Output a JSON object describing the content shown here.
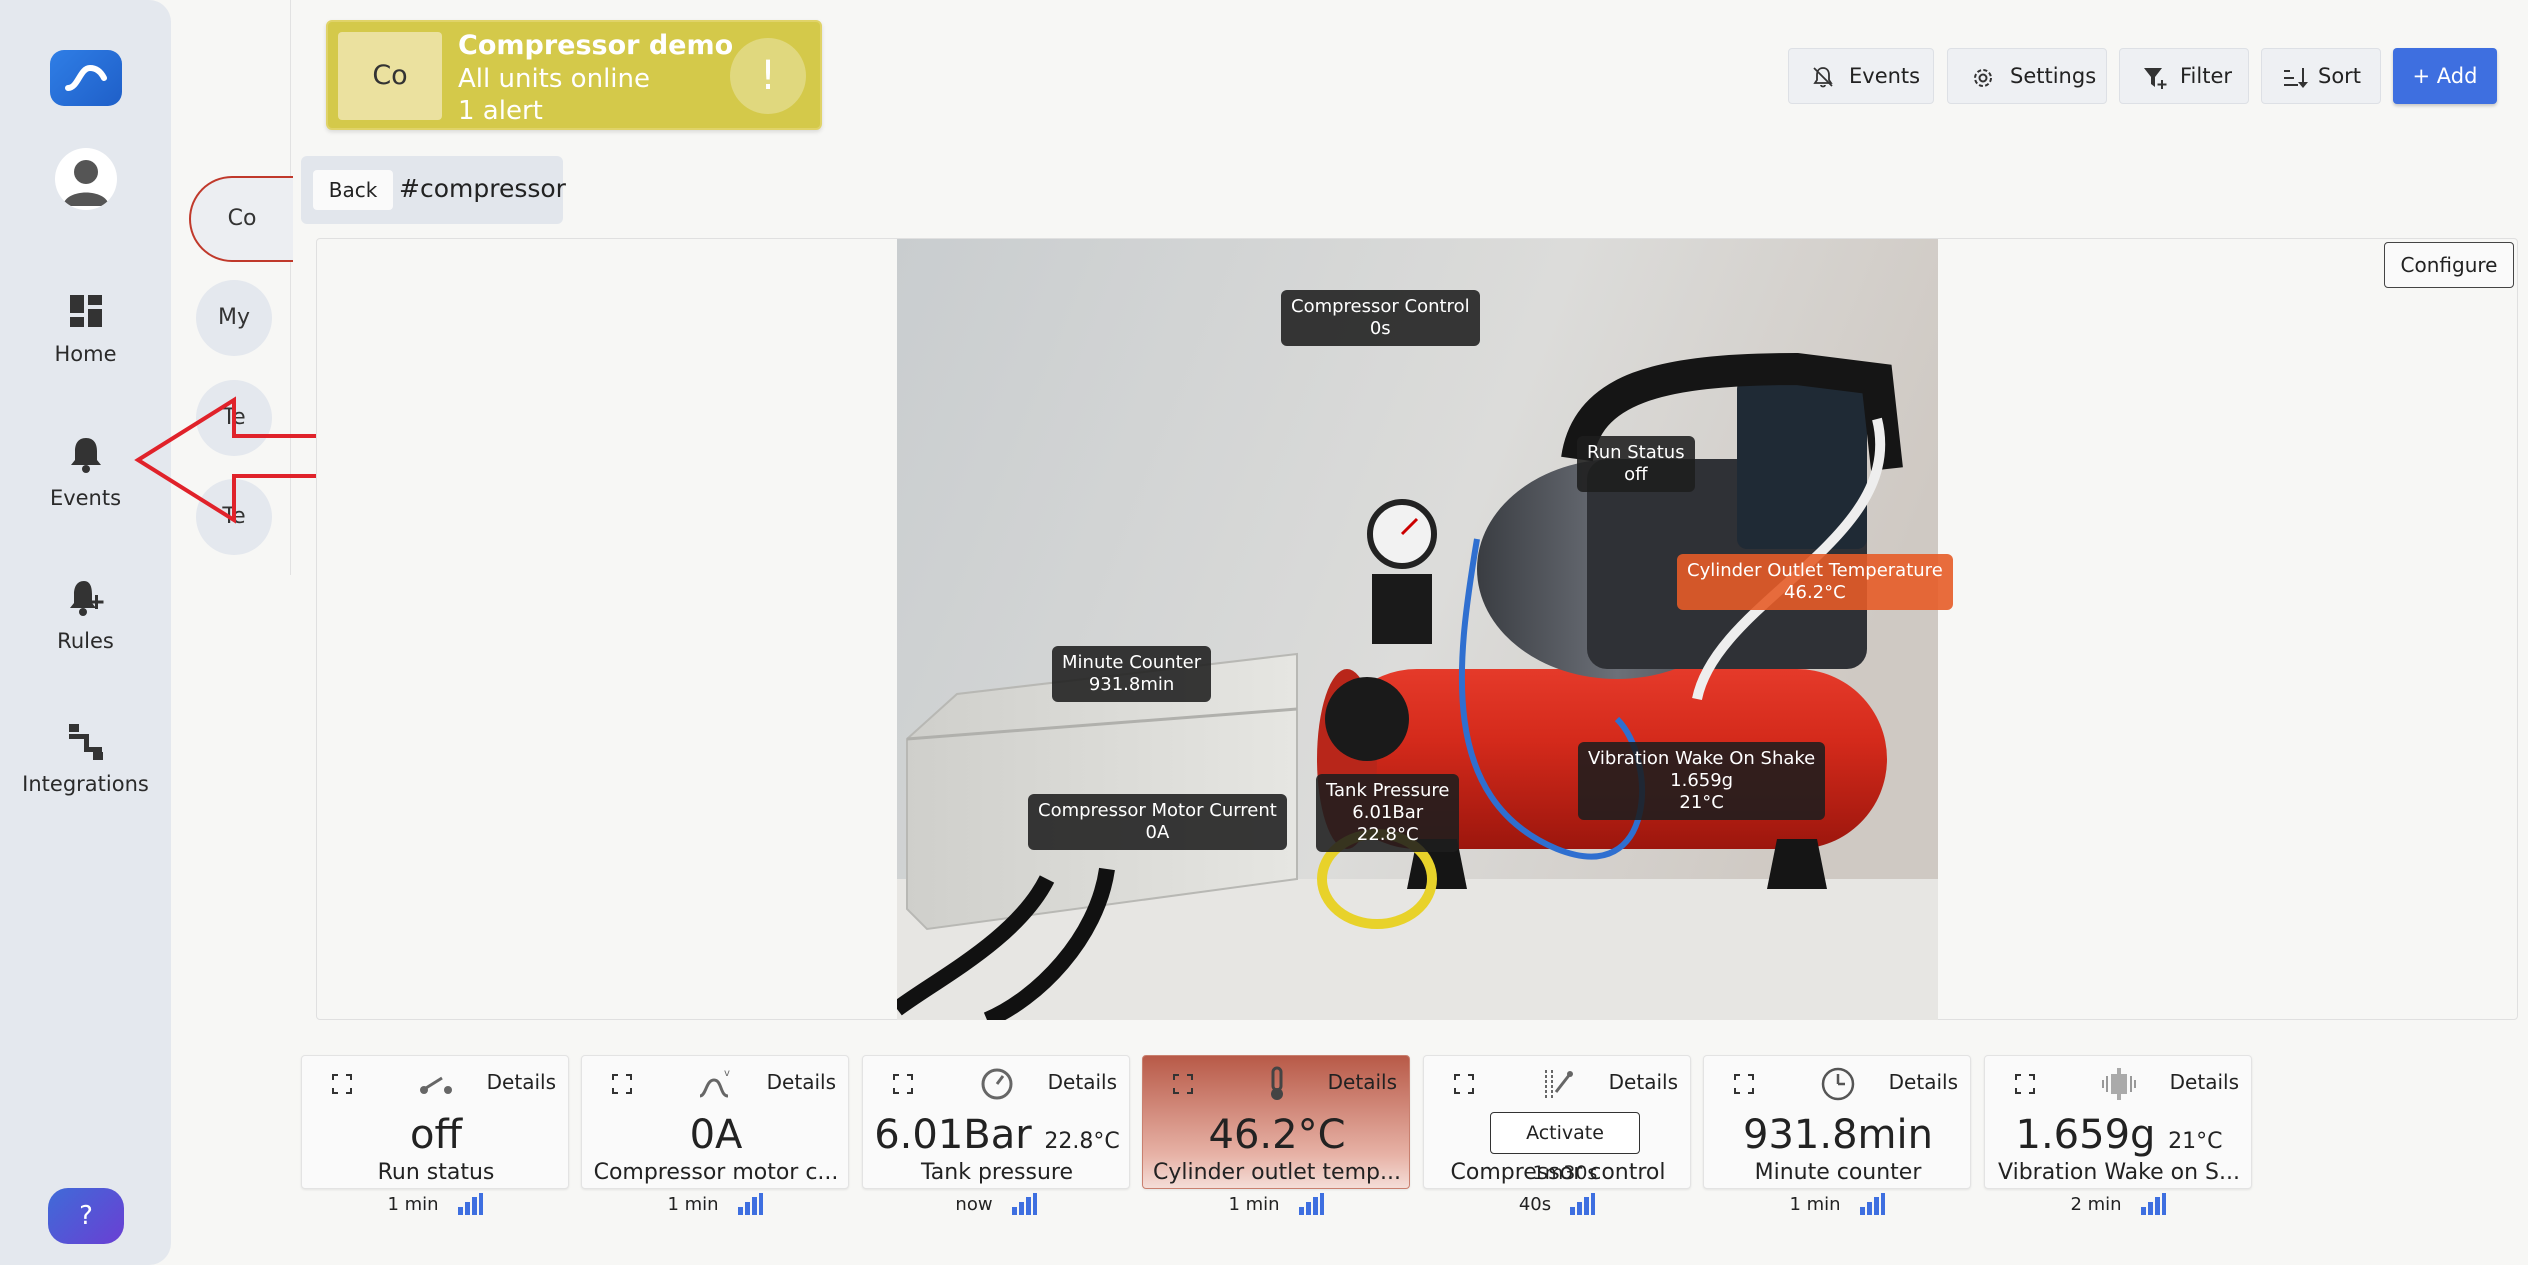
{
  "sidebar": {
    "items": [
      {
        "label": "Home",
        "icon": "dashboard-icon"
      },
      {
        "label": "Events",
        "icon": "bell-icon"
      },
      {
        "label": "Rules",
        "icon": "bell-plus-icon"
      },
      {
        "label": "Integrations",
        "icon": "integrations-icon"
      }
    ],
    "help_label": "?"
  },
  "subrail": {
    "chips": [
      "Co",
      "My",
      "Te",
      "Te"
    ]
  },
  "unit_card": {
    "abbr": "Co",
    "title": "Compressor demo",
    "status": "All units online",
    "alerts": "1 alert",
    "alert_symbol": "!",
    "color": "#d4c94a"
  },
  "toolbar": {
    "events_label": "Events",
    "settings_label": "Settings",
    "filter_label": "Filter",
    "sort_label": "Sort",
    "add_label": "+ Add",
    "accent": "#3e6fe0"
  },
  "breadcrumb": {
    "back_label": "Back",
    "tag": "#compressor"
  },
  "panel": {
    "configure_label": "Configure"
  },
  "overlays": [
    {
      "id": "compressor-control",
      "title": "Compressor Control",
      "lines": [
        "0s"
      ]
    },
    {
      "id": "run-status",
      "title": "Run Status",
      "lines": [
        "off"
      ]
    },
    {
      "id": "cylinder-outlet-temperature",
      "title": "Cylinder Outlet Temperature",
      "lines": [
        "46.2°C"
      ]
    },
    {
      "id": "minute-counter",
      "title": "Minute Counter",
      "lines": [
        "931.8min"
      ]
    },
    {
      "id": "vibration-wake-on-shake",
      "title": "Vibration Wake On Shake",
      "lines": [
        "1.659g",
        "21°C"
      ]
    },
    {
      "id": "tank-pressure",
      "title": "Tank Pressure",
      "lines": [
        "6.01Bar",
        "22.8°C"
      ]
    },
    {
      "id": "compressor-motor-current",
      "title": "Compressor Motor Current",
      "lines": [
        "0A"
      ]
    }
  ],
  "tiles": [
    {
      "value": "off",
      "sub": "",
      "name": "Run status",
      "age": "1 min",
      "details": "Details",
      "icon": "switch-icon"
    },
    {
      "value": "0A",
      "sub": "",
      "name": "Compressor motor c...",
      "age": "1 min",
      "details": "Details",
      "icon": "current-icon"
    },
    {
      "value": "6.01Bar",
      "sub": "22.8°C",
      "name": "Tank pressure",
      "age": "now",
      "details": "Details",
      "icon": "gauge-icon"
    },
    {
      "value": "46.2°C",
      "sub": "",
      "name": "Cylinder outlet temp...",
      "age": "1 min",
      "details": "Details",
      "icon": "thermometer-icon",
      "alert": true
    },
    {
      "button": "Activate 1m30s",
      "name": "Compressor control",
      "age": "40s",
      "details": "Details",
      "icon": "control-icon"
    },
    {
      "value": "931.8min",
      "sub": "",
      "name": "Minute counter",
      "age": "1 min",
      "details": "Details",
      "icon": "clock-icon"
    },
    {
      "value": "1.659g",
      "sub": "21°C",
      "name": "Vibration Wake on S...",
      "age": "2 min",
      "details": "Details",
      "icon": "vibration-icon"
    }
  ]
}
